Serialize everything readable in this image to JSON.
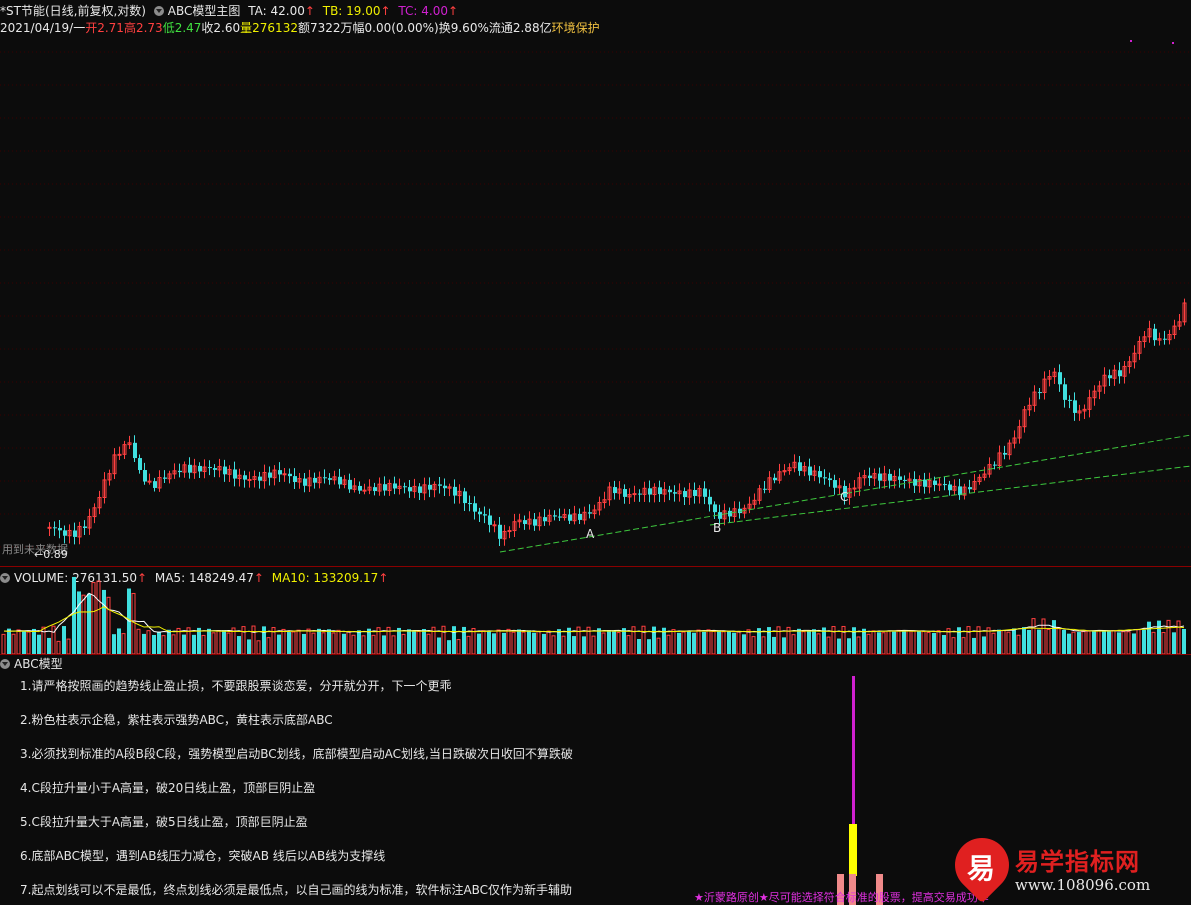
{
  "header": {
    "stock_name": "*ST节能",
    "period": "(日线,前复权,对数)",
    "indicator_name": "ABC模型主图",
    "ta": "TA: 42.00",
    "tb": "TB: 19.00",
    "tc": "TC: 4.00",
    "arrow": "↑"
  },
  "quote": {
    "date": "2021/04/19/一",
    "open": "开2.71",
    "high": "高2.73",
    "low": "低2.47",
    "close": "收2.60",
    "volume": "量276132",
    "amount": "额7322万",
    "amplitude": "幅0.00(0.00%)",
    "turnover": "换9.60%",
    "float": "流通2.88亿",
    "sector": "环境保护"
  },
  "chart_labels": {
    "point_a": "A",
    "point_b": "B",
    "point_c": "C",
    "future_data": "用到未来数据",
    "low_marker": "←0.89"
  },
  "volume_header": {
    "volume": "VOLUME: 276131.50",
    "ma5": "MA5: 148249.47",
    "ma10": "MA10: 133209.17",
    "arrow": "↑"
  },
  "abc_panel": {
    "title": "ABC模型",
    "notes": [
      "1.请严格按照画的趋势线止盈止损，不要跟股票谈恋爱，分开就分开，下一个更乖",
      "2.粉色柱表示企稳，紫柱表示强势ABC，黄柱表示底部ABC",
      "3.必须找到标准的A段B段C段，强势模型启动BC划线，底部模型启动AC划线,当日跌破次日收回不算跌破",
      "4.C段拉升量小于A高量，破20日线止盈，顶部巨阴止盈",
      "5.C段拉升量大于A高量，破5日线止盈，顶部巨阴止盈",
      "6.底部ABC模型，遇到AB线压力减仓，突破AB 线后以AB线为支撑线",
      "7.起点划线可以不是最低，终点划线必须是最低点，以自己画的线为标准，软件标注ABC仅作为新手辅助"
    ],
    "footer": "★沂蒙路原创★尽可能选择符合标准的股票，提高交易成功率"
  },
  "watermark": {
    "logo_char": "易",
    "name": "易学指标网",
    "url": "www.108096.com"
  },
  "colors": {
    "up": "#ff4040",
    "down": "#40e0e0",
    "ma5": "#ffffff",
    "ma10": "#f0f000",
    "trendline": "#3ec83e",
    "purple": "#d020d0",
    "yellow": "#ffff00",
    "pink": "#f08a8a"
  }
}
